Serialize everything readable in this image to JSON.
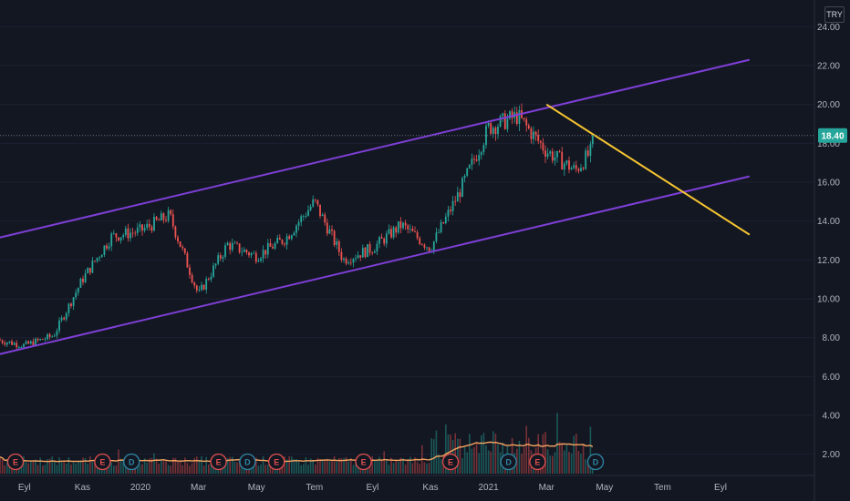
{
  "currency": "TRY",
  "chart_data": {
    "type": "candlestick",
    "price_axis": {
      "ticks": [
        "2.00",
        "4.00",
        "6.00",
        "8.00",
        "10.00",
        "12.00",
        "14.00",
        "16.00",
        "18.00",
        "20.00",
        "22.00",
        "24.00"
      ],
      "range": [
        1.0,
        25.0
      ]
    },
    "time_axis": {
      "ticks": [
        "Eyl",
        "Kas",
        "2020",
        "Mar",
        "May",
        "Tem",
        "Eyl",
        "Kas",
        "2021",
        "Mar",
        "May",
        "Tem",
        "Eyl"
      ]
    },
    "last_price": "18.40",
    "colors": {
      "up": "#26a69a",
      "down": "#ef5350",
      "channel": "#7e3fd6",
      "trendline": "#f7c531",
      "volume_ma": "#f4a460",
      "background": "#131722",
      "dividend": "#2f86a6",
      "earnings": "#e04f4f"
    },
    "price_path": [
      {
        "t": "2019-08",
        "close": 7.9
      },
      {
        "t": "2019-09",
        "close": 7.6
      },
      {
        "t": "2019-10",
        "close": 8.1
      },
      {
        "t": "2019-11",
        "close": 11.0
      },
      {
        "t": "2019-12",
        "close": 13.2
      },
      {
        "t": "2020-01",
        "close": 13.5
      },
      {
        "t": "2020-02",
        "close": 14.3
      },
      {
        "t": "2020-03",
        "close": 10.2
      },
      {
        "t": "2020-04",
        "close": 12.8
      },
      {
        "t": "2020-05",
        "close": 12.2
      },
      {
        "t": "2020-06",
        "close": 13.1
      },
      {
        "t": "2020-07",
        "close": 15.0
      },
      {
        "t": "2020-08",
        "close": 12.0
      },
      {
        "t": "2020-09",
        "close": 12.6
      },
      {
        "t": "2020-10",
        "close": 13.8
      },
      {
        "t": "2020-11",
        "close": 12.6
      },
      {
        "t": "2020-12",
        "close": 15.5
      },
      {
        "t": "2021-01",
        "close": 18.8
      },
      {
        "t": "2021-02",
        "close": 19.4
      },
      {
        "t": "2021-03",
        "close": 17.6
      },
      {
        "t": "2021-04",
        "close": 16.6
      },
      {
        "t": "2021-05",
        "close": 18.4
      }
    ],
    "channel_upper": [
      {
        "t": "2019-08",
        "y": 13.1
      },
      {
        "t": "2021-10",
        "y": 22.3
      }
    ],
    "channel_lower": [
      {
        "t": "2019-08",
        "y": 7.1
      },
      {
        "t": "2021-10",
        "y": 16.3
      }
    ],
    "trendline": [
      {
        "t": "2021-03",
        "y": 20.0
      },
      {
        "t": "2021-10",
        "y": 13.3
      }
    ],
    "events": [
      {
        "type": "earnings",
        "label": "E",
        "t": "2019-08"
      },
      {
        "type": "earnings",
        "label": "E",
        "t": "2019-11"
      },
      {
        "type": "dividend",
        "label": "D",
        "t": "2019-12"
      },
      {
        "type": "earnings",
        "label": "E",
        "t": "2020-03"
      },
      {
        "type": "dividend",
        "label": "D",
        "t": "2020-04"
      },
      {
        "type": "earnings",
        "label": "E",
        "t": "2020-05"
      },
      {
        "type": "earnings",
        "label": "E",
        "t": "2020-08"
      },
      {
        "type": "earnings",
        "label": "E",
        "t": "2020-11"
      },
      {
        "type": "dividend",
        "label": "D",
        "t": "2021-01"
      },
      {
        "type": "earnings",
        "label": "E",
        "t": "2021-02"
      },
      {
        "type": "dividend",
        "label": "D",
        "t": "2021-04"
      }
    ]
  }
}
